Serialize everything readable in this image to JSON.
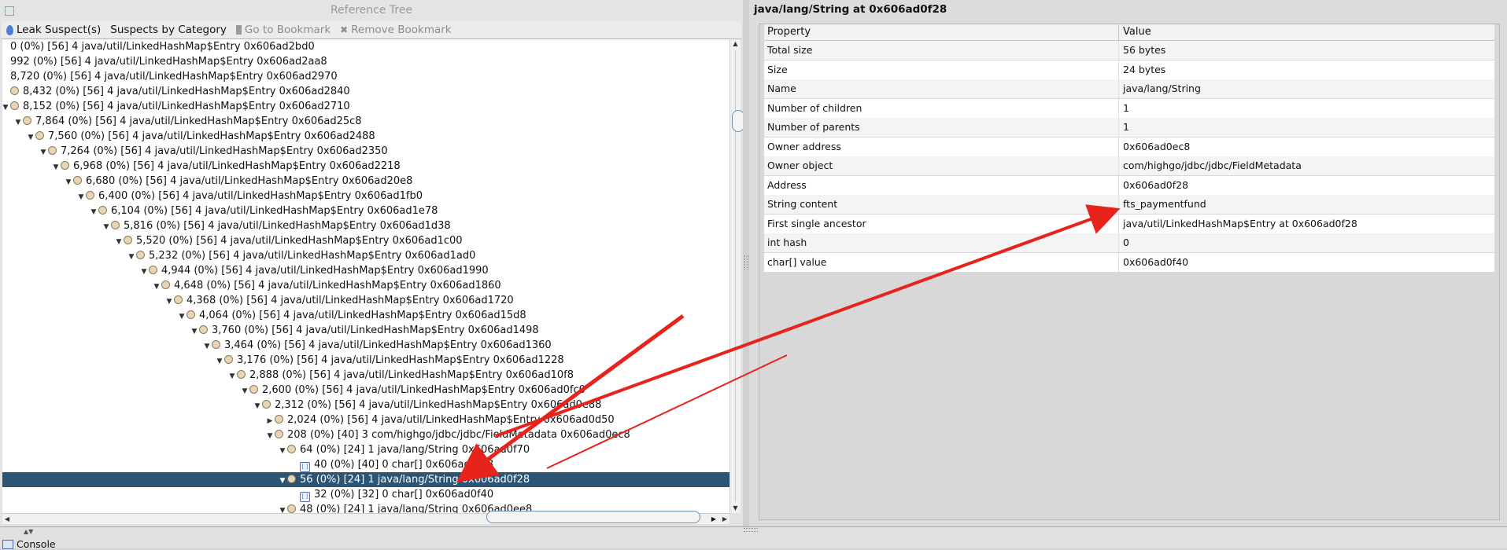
{
  "left_pane": {
    "title": "Reference Tree",
    "tabs": [
      {
        "label": "Leak Suspect(s)",
        "icon": "leak-suspect-icon",
        "enabled": true
      },
      {
        "label": "Suspects by Category",
        "icon": "",
        "enabled": true
      },
      {
        "label": "Go to Bookmark",
        "icon": "bookmark-icon",
        "enabled": false
      },
      {
        "label": "Remove Bookmark",
        "icon": "remove-bookmark-icon",
        "enabled": false
      }
    ],
    "tree_rows": [
      {
        "depth": 0,
        "toggle": "",
        "icon": "none",
        "text": "0 (0%) [56] 4 java/util/LinkedHashMap$Entry 0x606ad2bd0"
      },
      {
        "depth": 0,
        "toggle": "",
        "icon": "none",
        "text": "992 (0%) [56] 4 java/util/LinkedHashMap$Entry 0x606ad2aa8"
      },
      {
        "depth": 0,
        "toggle": "",
        "icon": "none",
        "text": "8,720 (0%) [56] 4 java/util/LinkedHashMap$Entry 0x606ad2970"
      },
      {
        "depth": 0,
        "toggle": "",
        "icon": "object",
        "text": "8,432 (0%) [56] 4 java/util/LinkedHashMap$Entry 0x606ad2840"
      },
      {
        "depth": 0,
        "toggle": "expanded",
        "icon": "object",
        "text": "8,152 (0%) [56] 4 java/util/LinkedHashMap$Entry 0x606ad2710"
      },
      {
        "depth": 1,
        "toggle": "expanded",
        "icon": "object",
        "text": "7,864 (0%) [56] 4 java/util/LinkedHashMap$Entry 0x606ad25c8"
      },
      {
        "depth": 2,
        "toggle": "expanded",
        "icon": "object",
        "text": "7,560 (0%) [56] 4 java/util/LinkedHashMap$Entry 0x606ad2488"
      },
      {
        "depth": 3,
        "toggle": "expanded",
        "icon": "object",
        "text": "7,264 (0%) [56] 4 java/util/LinkedHashMap$Entry 0x606ad2350"
      },
      {
        "depth": 4,
        "toggle": "expanded",
        "icon": "object",
        "text": "6,968 (0%) [56] 4 java/util/LinkedHashMap$Entry 0x606ad2218"
      },
      {
        "depth": 5,
        "toggle": "expanded",
        "icon": "object",
        "text": "6,680 (0%) [56] 4 java/util/LinkedHashMap$Entry 0x606ad20e8"
      },
      {
        "depth": 6,
        "toggle": "expanded",
        "icon": "object",
        "text": "6,400 (0%) [56] 4 java/util/LinkedHashMap$Entry 0x606ad1fb0"
      },
      {
        "depth": 7,
        "toggle": "expanded",
        "icon": "object",
        "text": "6,104 (0%) [56] 4 java/util/LinkedHashMap$Entry 0x606ad1e78"
      },
      {
        "depth": 8,
        "toggle": "expanded",
        "icon": "object",
        "text": "5,816 (0%) [56] 4 java/util/LinkedHashMap$Entry 0x606ad1d38"
      },
      {
        "depth": 9,
        "toggle": "expanded",
        "icon": "object",
        "text": "5,520 (0%) [56] 4 java/util/LinkedHashMap$Entry 0x606ad1c00"
      },
      {
        "depth": 10,
        "toggle": "expanded",
        "icon": "object",
        "text": "5,232 (0%) [56] 4 java/util/LinkedHashMap$Entry 0x606ad1ad0"
      },
      {
        "depth": 11,
        "toggle": "expanded",
        "icon": "object",
        "text": "4,944 (0%) [56] 4 java/util/LinkedHashMap$Entry 0x606ad1990"
      },
      {
        "depth": 12,
        "toggle": "expanded",
        "icon": "object",
        "text": "4,648 (0%) [56] 4 java/util/LinkedHashMap$Entry 0x606ad1860"
      },
      {
        "depth": 13,
        "toggle": "expanded",
        "icon": "object",
        "text": "4,368 (0%) [56] 4 java/util/LinkedHashMap$Entry 0x606ad1720"
      },
      {
        "depth": 14,
        "toggle": "expanded",
        "icon": "object",
        "text": "4,064 (0%) [56] 4 java/util/LinkedHashMap$Entry 0x606ad15d8"
      },
      {
        "depth": 15,
        "toggle": "expanded",
        "icon": "object",
        "text": "3,760 (0%) [56] 4 java/util/LinkedHashMap$Entry 0x606ad1498"
      },
      {
        "depth": 16,
        "toggle": "expanded",
        "icon": "object",
        "text": "3,464 (0%) [56] 4 java/util/LinkedHashMap$Entry 0x606ad1360"
      },
      {
        "depth": 17,
        "toggle": "expanded",
        "icon": "object",
        "text": "3,176 (0%) [56] 4 java/util/LinkedHashMap$Entry 0x606ad1228"
      },
      {
        "depth": 18,
        "toggle": "expanded",
        "icon": "object",
        "text": "2,888 (0%) [56] 4 java/util/LinkedHashMap$Entry 0x606ad10f8"
      },
      {
        "depth": 19,
        "toggle": "expanded",
        "icon": "object",
        "text": "2,600 (0%) [56] 4 java/util/LinkedHashMap$Entry 0x606ad0fc0"
      },
      {
        "depth": 20,
        "toggle": "expanded",
        "icon": "object",
        "text": "2,312 (0%) [56] 4 java/util/LinkedHashMap$Entry 0x606ad0e88"
      },
      {
        "depth": 21,
        "toggle": "collapsed",
        "icon": "object",
        "text": "2,024 (0%) [56] 4 java/util/LinkedHashMap$Entry 0x606ad0d50"
      },
      {
        "depth": 21,
        "toggle": "expanded",
        "icon": "object",
        "text": "208 (0%) [40] 3 com/highgo/jdbc/jdbc/FieldMetadata 0x606ad0ec8"
      },
      {
        "depth": 22,
        "toggle": "expanded",
        "icon": "object",
        "text": "64 (0%) [24] 1 java/lang/String 0x606ad0f70"
      },
      {
        "depth": 23,
        "toggle": "",
        "icon": "array",
        "text": "40 (0%) [40] 0 char[] 0x606ad0fb8"
      },
      {
        "depth": 22,
        "toggle": "expanded",
        "icon": "object",
        "text": "56 (0%) [24] 1 java/lang/String 0x606ad0f28",
        "selected": true
      },
      {
        "depth": 23,
        "toggle": "",
        "icon": "array",
        "text": "32 (0%) [32] 0 char[] 0x606ad0f40"
      },
      {
        "depth": 22,
        "toggle": "expanded",
        "icon": "object",
        "text": "48 (0%) [24] 1 java/lang/String 0x606ad0ee8"
      }
    ]
  },
  "right_pane": {
    "title": "java/lang/String at 0x606ad0f28",
    "columns": {
      "property": "Property",
      "value": "Value"
    },
    "properties": [
      {
        "key": "Total size",
        "value": "56 bytes"
      },
      {
        "key": "Size",
        "value": "24 bytes"
      },
      {
        "key": "Name",
        "value": "java/lang/String"
      },
      {
        "key": "Number of children",
        "value": "1"
      },
      {
        "key": "Number of parents",
        "value": "1"
      },
      {
        "key": "Owner address",
        "value": "0x606ad0ec8"
      },
      {
        "key": "Owner object",
        "value": "com/highgo/jdbc/jdbc/FieldMetadata"
      },
      {
        "key": "Address",
        "value": "0x606ad0f28"
      },
      {
        "key": "String content",
        "value": "fts_paymentfund"
      },
      {
        "key": "First single ancestor",
        "value": "java/util/LinkedHashMap$Entry at 0x606ad0f28"
      },
      {
        "key": "int hash",
        "value": "0"
      },
      {
        "key": "char[] value",
        "value": "0x606ad0f40"
      }
    ]
  },
  "bottom": {
    "console_label": "Console"
  },
  "colors": {
    "selection": "#2c5575",
    "annotation_arrow": "#e8231b"
  }
}
